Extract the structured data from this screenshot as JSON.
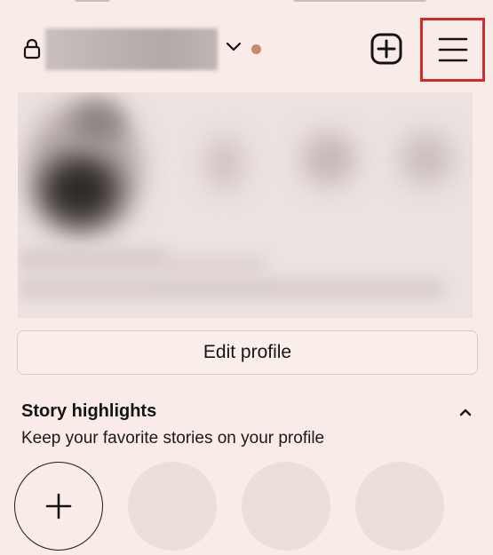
{
  "header": {
    "lock_icon": "lock-icon",
    "dropdown_icon": "chevron-down-icon",
    "notification_color": "#c98a6c",
    "create_icon": "plus-square-icon",
    "menu_icon": "hamburger-menu-icon",
    "highlight_box_color": "#d12c2c"
  },
  "profile": {
    "edit_button_label": "Edit profile"
  },
  "highlights": {
    "title": "Story highlights",
    "subtitle": "Keep your favorite stories on your profile",
    "collapse_icon": "chevron-up-icon",
    "new_icon": "plus-icon",
    "placeholder_count": 3
  },
  "colors": {
    "background": "#f9ebe8",
    "button_border": "#d9cbc8",
    "placeholder": "#ecdedb"
  }
}
